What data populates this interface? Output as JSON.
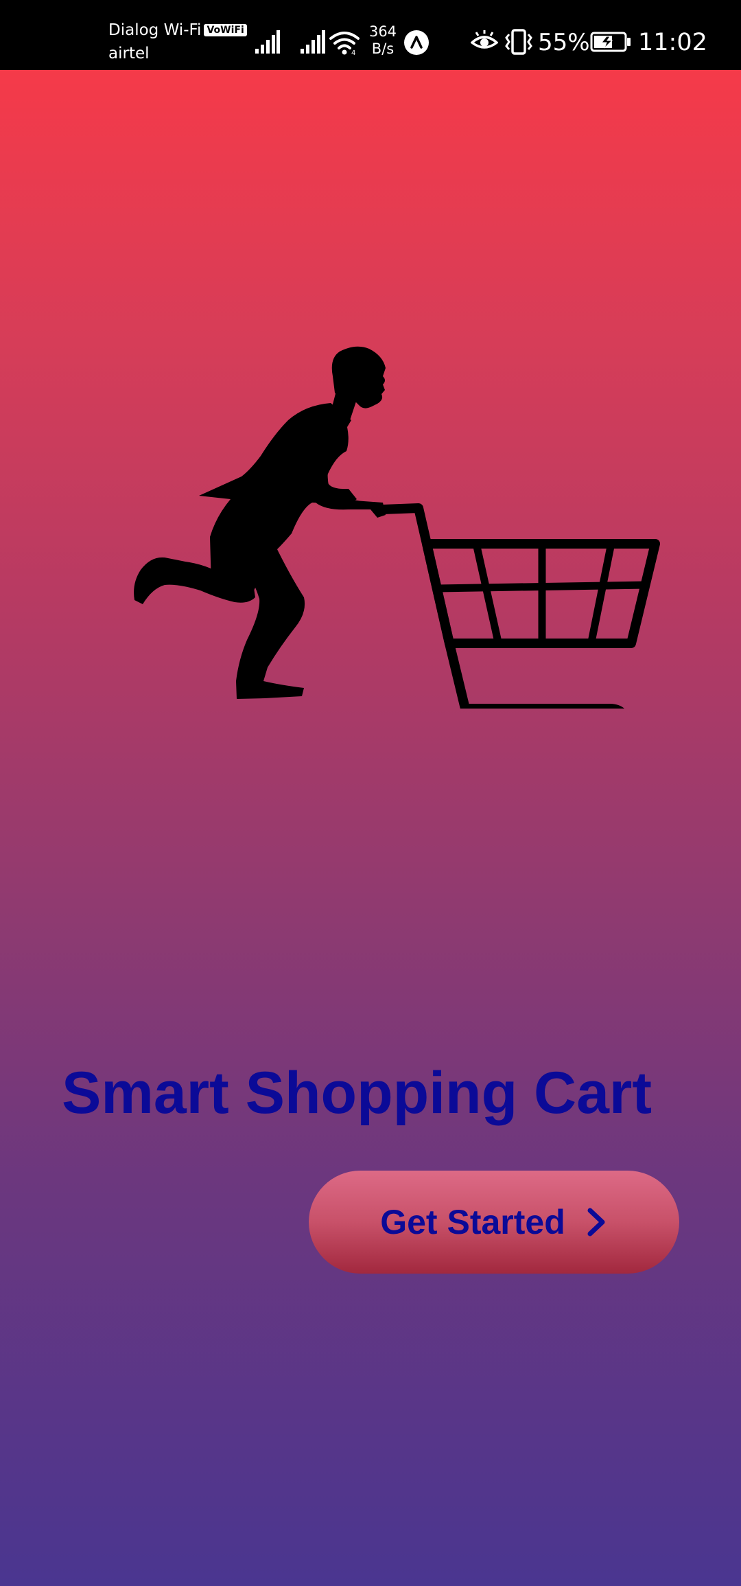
{
  "status_bar": {
    "carrier_primary": "Dialog Wi-Fi",
    "vowifi_badge": "VoWiFi",
    "carrier_secondary": "airtel",
    "net_speed_value": "364",
    "net_speed_unit": "B/s",
    "battery_percent": "55%",
    "time": "11:02",
    "icons": [
      "signal-bars-icon",
      "signal-bars-icon",
      "wifi-icon",
      "app-notification-icon",
      "eye-comfort-icon",
      "vibrate-icon",
      "battery-charging-icon"
    ]
  },
  "hero": {
    "illustration": "person-pushing-shopping-cart"
  },
  "main": {
    "title": "Smart Shopping Cart",
    "cta_label": "Get Started",
    "cta_icon": "chevron-right-icon"
  },
  "colors": {
    "title_text": "#0b0a97",
    "gradient_top": "#f53a49",
    "gradient_bottom": "#4a3690",
    "button_top": "#dd6a86",
    "button_bottom": "#a2283e"
  }
}
